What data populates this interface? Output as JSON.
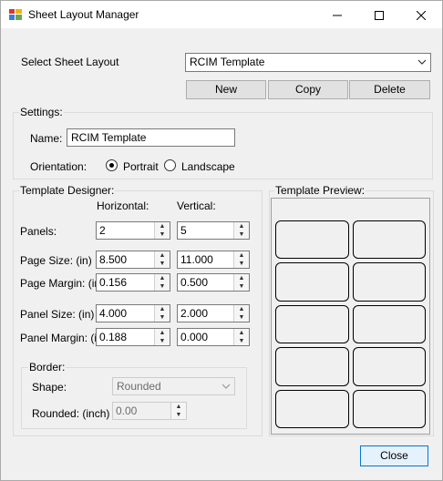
{
  "window": {
    "title": "Sheet Layout Manager",
    "minimize_icon": "minimize-icon",
    "maximize_icon": "maximize-icon",
    "close_icon": "close-icon"
  },
  "select_layout": {
    "label": "Select Sheet Layout",
    "value": "RCIM Template"
  },
  "actions": {
    "new_label": "New",
    "copy_label": "Copy",
    "delete_label": "Delete"
  },
  "settings": {
    "group_title": "Settings:",
    "name_label": "Name:",
    "name_value": "RCIM Template",
    "orientation_label": "Orientation:",
    "portrait_label": "Portrait",
    "landscape_label": "Landscape",
    "selected_orientation": "Portrait"
  },
  "designer": {
    "group_title": "Template Designer:",
    "horizontal_header": "Horizontal:",
    "vertical_header": "Vertical:",
    "rows": [
      {
        "label": "Panels:",
        "horizontal": "2",
        "vertical": "5"
      },
      {
        "label": "Page Size: (in)",
        "horizontal": "8.500",
        "vertical": "11.000"
      },
      {
        "label": "Page Margin: (in)",
        "horizontal": "0.156",
        "vertical": "0.500"
      },
      {
        "label": "Panel Size: (in)",
        "horizontal": "4.000",
        "vertical": "2.000"
      },
      {
        "label": "Panel Margin: (in)",
        "horizontal": "0.188",
        "vertical": "0.000"
      }
    ],
    "border": {
      "group_title": "Border:",
      "shape_label": "Shape:",
      "shape_value": "Rounded",
      "rounded_label": "Rounded: (inch)",
      "rounded_value": "0.00"
    }
  },
  "preview": {
    "group_title": "Template Preview:",
    "columns": 2,
    "rows": 5
  },
  "footer": {
    "close_label": "Close"
  }
}
